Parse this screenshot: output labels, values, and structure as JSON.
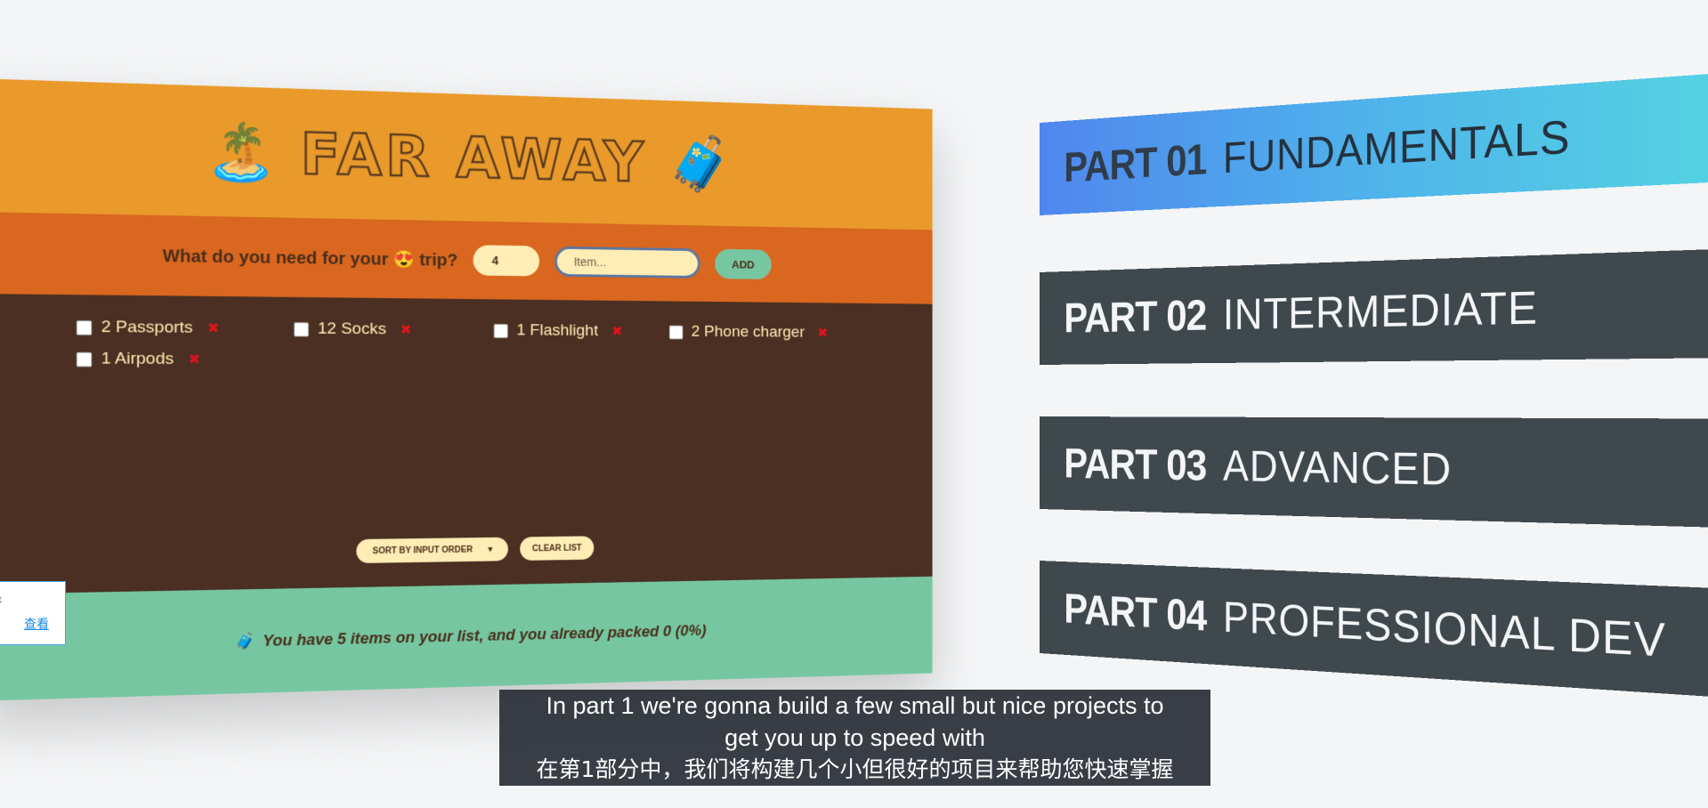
{
  "app": {
    "logo_left_emoji": "🏝️",
    "title": "FAR AWAY",
    "logo_right_emoji": "🧳",
    "form": {
      "question": "What do you need for your 😍 trip?",
      "quantity_value": "4",
      "item_placeholder": "Item...",
      "add_label": "ADD"
    },
    "items": [
      {
        "label": "2 Passports"
      },
      {
        "label": "12 Socks"
      },
      {
        "label": "1 Flashlight"
      },
      {
        "label": "2 Phone charger"
      },
      {
        "label": "1 Airpods"
      }
    ],
    "delete_glyph": "✖",
    "sort_label": "SORT BY INPUT ORDER",
    "clear_label": "CLEAR LIST",
    "stats_emoji": "🧳",
    "stats_text": "You have 5 items on your list, and you already packed 0 (0%)"
  },
  "parts": [
    {
      "num": "PART 01",
      "title": "FUNDAMENTALS",
      "active": true
    },
    {
      "num": "PART 02",
      "title": "INTERMEDIATE",
      "active": false
    },
    {
      "num": "PART 03",
      "title": "ADVANCED",
      "active": false
    },
    {
      "num": "PART 04",
      "title": "PROFESSIONAL DEV",
      "active": false
    }
  ],
  "popup": {
    "mark": "ε",
    "link": "查看"
  },
  "subtitles": {
    "en_line1": "In part 1 we're gonna build a few small but nice projects to",
    "en_line2": "get you up to speed with",
    "zh": "在第1部分中，我们将构建几个小但很好的项目来帮助您快速掌握"
  },
  "colors": {
    "header": "#e99a2a",
    "form_bar": "#d9671f",
    "list_bg": "#4a2f22",
    "stats_bar": "#76c7a1",
    "part_dark": "#3f484c",
    "part_active_start": "#4f86ee",
    "part_active_end": "#55d3e2"
  }
}
